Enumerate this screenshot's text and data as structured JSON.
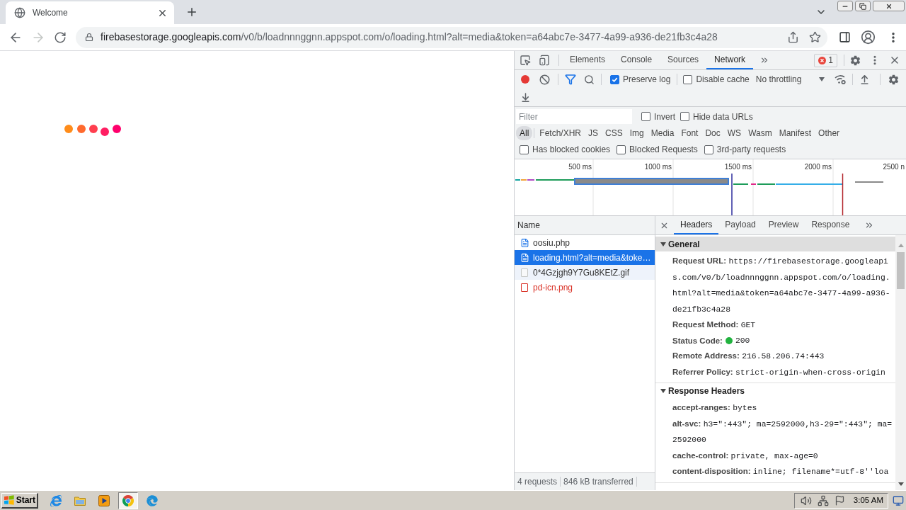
{
  "browser": {
    "tab": {
      "title": "Welcome"
    },
    "nav": {
      "back_disabled": false,
      "forward_disabled": true
    },
    "address": {
      "host": "firebasestorage.googleapis.com",
      "path": "/v0/b/loadnnnggnn.appspot.com/o/loading.html?alt=media&token=a64abc7e-3477-4a99-a936-de21fb3c4a28"
    }
  },
  "devtools": {
    "tabs": [
      {
        "label": "Elements",
        "selected": false
      },
      {
        "label": "Console",
        "selected": false
      },
      {
        "label": "Sources",
        "selected": false
      },
      {
        "label": "Network",
        "selected": true
      }
    ],
    "error_count": "1",
    "toolbar": {
      "recording": true,
      "options": [
        {
          "label": "Preserve log",
          "checked": true
        },
        {
          "label": "Disable cache",
          "checked": false
        }
      ],
      "throttling": "No throttling"
    },
    "filter": {
      "placeholder": "Filter",
      "options": [
        {
          "label": "Invert",
          "checked": false
        },
        {
          "label": "Hide data URLs",
          "checked": false
        }
      ],
      "types": [
        {
          "label": "All",
          "selected": true
        },
        {
          "label": "Fetch/XHR",
          "selected": false
        },
        {
          "label": "JS",
          "selected": false
        },
        {
          "label": "CSS",
          "selected": false
        },
        {
          "label": "Img",
          "selected": false
        },
        {
          "label": "Media",
          "selected": false
        },
        {
          "label": "Font",
          "selected": false
        },
        {
          "label": "Doc",
          "selected": false
        },
        {
          "label": "WS",
          "selected": false
        },
        {
          "label": "Wasm",
          "selected": false
        },
        {
          "label": "Manifest",
          "selected": false
        },
        {
          "label": "Other",
          "selected": false
        }
      ],
      "more_options": [
        {
          "label": "Has blocked cookies",
          "checked": false
        },
        {
          "label": "Blocked Requests",
          "checked": false
        },
        {
          "label": "3rd-party requests",
          "checked": false
        }
      ]
    },
    "overview": {
      "ticks": [
        "500 ms",
        "1000 ms",
        "1500 ms",
        "2000 ms",
        "2500 n"
      ]
    },
    "requests": {
      "column": "Name",
      "rows": [
        {
          "kind": "document",
          "name": "oosiu.php",
          "selected": false,
          "hovered": false,
          "failed": false
        },
        {
          "kind": "document",
          "name": "loading.html?alt=media&toke…",
          "selected": true,
          "hovered": false,
          "failed": false
        },
        {
          "kind": "image",
          "name": "0*4Gzjgh9Y7Gu8KEtZ.gif",
          "selected": false,
          "hovered": true,
          "failed": false
        },
        {
          "kind": "image",
          "name": "pd-icn.png",
          "selected": false,
          "hovered": false,
          "failed": true
        }
      ],
      "summary": [
        "4 requests",
        "846 kB transferred"
      ]
    },
    "details": {
      "tabs": [
        {
          "label": "Headers",
          "selected": true
        },
        {
          "label": "Payload",
          "selected": false
        },
        {
          "label": "Preview",
          "selected": false
        },
        {
          "label": "Response",
          "selected": false
        }
      ],
      "sections": [
        {
          "title": "General",
          "expanded": true,
          "hovered": true,
          "rows": [
            {
              "kind": "plain",
              "key": "Request URL:",
              "value": "https://firebasestorage.googleapis.com/v0/b/loadnnnggnn.appspot.com/o/loading.html?alt=media&token=a64abc7e-3477-4a99-a936-de21fb3c4a28"
            },
            {
              "kind": "plain",
              "key": "Request Method:",
              "value": "GET"
            },
            {
              "kind": "status",
              "key": "Status Code:",
              "value": "200"
            },
            {
              "kind": "plain",
              "key": "Remote Address:",
              "value": "216.58.206.74:443"
            },
            {
              "kind": "plain",
              "key": "Referrer Policy:",
              "value": "strict-origin-when-cross-origin"
            }
          ]
        },
        {
          "title": "Response Headers",
          "expanded": true,
          "hovered": false,
          "rows": [
            {
              "kind": "plain",
              "key": "accept-ranges:",
              "value": "bytes"
            },
            {
              "kind": "plain",
              "key": "alt-svc:",
              "value": "h3=\":443\"; ma=2592000,h3-29=\":443\"; ma=2592000"
            },
            {
              "kind": "plain",
              "key": "cache-control:",
              "value": "private, max-age=0"
            },
            {
              "kind": "plain",
              "key": "content-disposition:",
              "value": "inline; filename*=utf-8''loa"
            }
          ]
        }
      ]
    }
  },
  "taskbar": {
    "start": "Start",
    "apps": [
      {
        "kind": "ie",
        "active": false
      },
      {
        "kind": "folder",
        "active": false
      },
      {
        "kind": "media",
        "active": false
      },
      {
        "kind": "chrome",
        "active": true
      },
      {
        "kind": "edge",
        "active": false
      }
    ],
    "clock": "3:05 AM"
  }
}
